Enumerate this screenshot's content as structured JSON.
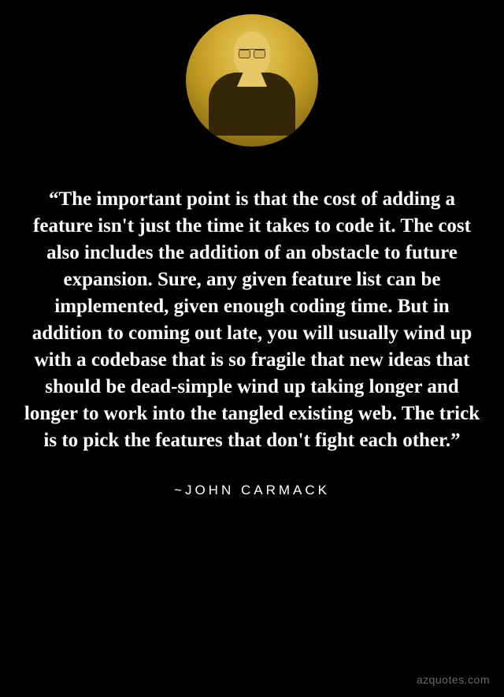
{
  "avatar": {
    "alt": "portrait-photo"
  },
  "quote": {
    "text": "“The important point is that the cost of adding a feature isn't just the time it takes to code it. The cost also includes the addition of an obstacle to future expansion. Sure, any given feature list can be implemented, given enough coding time. But in addition to coming out late, you will usually wind up with a codebase that is so fragile that new ideas that should be dead-simple wind up taking longer and longer to work into the tangled existing web. The trick is to pick the features that don't fight each other.”"
  },
  "author": {
    "prefix": "~",
    "name": "JOHN CARMACK"
  },
  "watermark": "azquotes.com"
}
